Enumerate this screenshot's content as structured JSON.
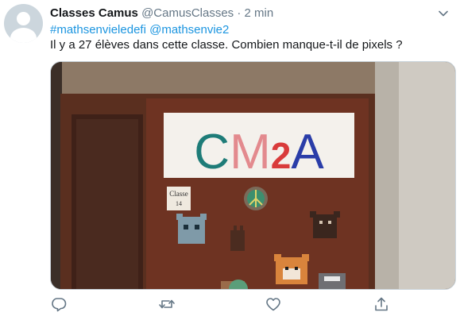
{
  "tweet": {
    "author_name": "Classes Camus",
    "author_handle": "@CamusClasses",
    "separator": "·",
    "timestamp": "2 min",
    "hashtag_1": "#mathsenvieledefi",
    "mention_1": "@mathsenvie2",
    "body": "Il y a 27 élèves dans cette classe. Combien manque-t-il de pixels ?"
  },
  "photo": {
    "banner_text": "CM2A",
    "door_sign_line1": "Classe",
    "door_sign_line2": "14"
  },
  "icons": {
    "avatar": "default-avatar",
    "menu": "chevron-down-icon",
    "reply": "reply-icon",
    "retweet": "retweet-icon",
    "like": "heart-icon",
    "share": "share-icon"
  },
  "colors": {
    "link": "#1b95e0",
    "secondary_text": "#657786",
    "icon": "#657786"
  }
}
